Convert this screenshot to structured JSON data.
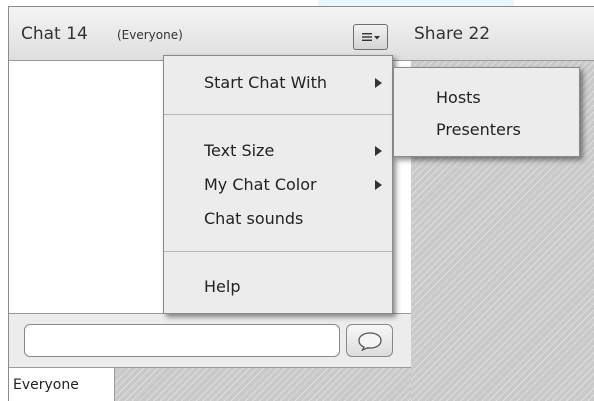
{
  "chat_pod": {
    "title": "Chat 14",
    "scope": "(Everyone)",
    "tabs": [
      {
        "label": "Everyone"
      }
    ]
  },
  "share_pod": {
    "title": "Share 22"
  },
  "chat_menu": {
    "items": [
      {
        "label": "Start Chat With",
        "has_submenu": true
      },
      {
        "label": "Text Size",
        "has_submenu": true
      },
      {
        "label": "My Chat Color",
        "has_submenu": true
      },
      {
        "label": "Chat sounds",
        "has_submenu": false
      },
      {
        "label": "Help",
        "has_submenu": false
      }
    ]
  },
  "submenu": {
    "items": [
      {
        "label": "Hosts"
      },
      {
        "label": "Presenters"
      }
    ]
  },
  "colors": {
    "header_bg": "#e4e4e4",
    "menu_bg": "#ececec",
    "hatch_bg": "#c9c9c9",
    "top_highlight": "#eaf6fd"
  },
  "icons": {
    "menu_button": "menu-lines-dropdown-icon",
    "send_button": "speech-bubble-icon"
  }
}
